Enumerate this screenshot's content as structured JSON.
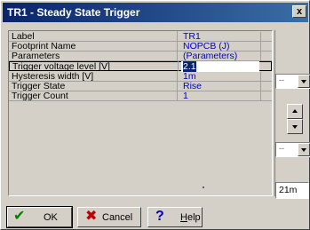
{
  "window": {
    "title": "TR1 - Steady State Trigger",
    "close_label": "x"
  },
  "properties": [
    {
      "label": "Label",
      "value": "TR1"
    },
    {
      "label": "Footprint Name",
      "value": "NOPCB (J)"
    },
    {
      "label": "Parameters",
      "value": "(Parameters)"
    },
    {
      "label": "Trigger voltage level [V]",
      "value": "2.1",
      "editing": true
    },
    {
      "label": "Hysteresis width [V]",
      "value": "1m"
    },
    {
      "label": "Trigger State",
      "value": "Rise"
    },
    {
      "label": "Trigger Count",
      "value": "1"
    }
  ],
  "right_panel": {
    "combo_top_text": "--",
    "combo_bottom_text": "--",
    "value_box": "21m"
  },
  "buttons": {
    "ok": "OK",
    "cancel": "Cancel",
    "help_prefix": "",
    "help_underlined": "H",
    "help_rest": "elp"
  },
  "icons": {
    "ok": "checkmark-icon",
    "cancel": "x-cross-icon",
    "help": "question-mark-icon"
  },
  "colors": {
    "titlebar": "#0a246a",
    "value_text": "#0000c0",
    "ok_icon": "#008000",
    "cancel_icon": "#c00000",
    "help_icon": "#0000c0"
  }
}
